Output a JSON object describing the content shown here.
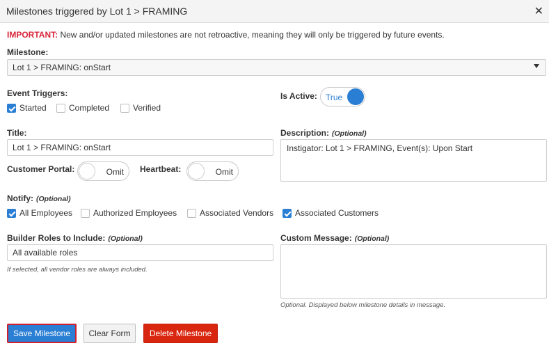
{
  "dialog": {
    "title": "Milestones triggered by Lot 1 > FRAMING",
    "close_glyph": "✕"
  },
  "notice": {
    "label": "IMPORTANT:",
    "text": " New and/or updated milestones are not retroactive, meaning they will only be triggered by future events."
  },
  "milestone": {
    "label": "Milestone:",
    "selected": "Lot 1 > FRAMING: onStart"
  },
  "event_triggers": {
    "label": "Event Triggers:",
    "options": [
      {
        "label": "Started",
        "checked": true
      },
      {
        "label": "Completed",
        "checked": false
      },
      {
        "label": "Verified",
        "checked": false
      }
    ]
  },
  "is_active": {
    "label": "Is Active:",
    "value": "True",
    "on": true
  },
  "title_field": {
    "label": "Title:",
    "value": "Lot 1 > FRAMING: onStart"
  },
  "description": {
    "label": "Description:",
    "optional": "(Optional)",
    "value": "Instigator: Lot 1 > FRAMING, Event(s): Upon Start"
  },
  "customer_portal": {
    "label": "Customer Portal:",
    "value": "Omit",
    "on": false
  },
  "heartbeat": {
    "label": "Heartbeat:",
    "value": "Omit",
    "on": false
  },
  "notify": {
    "label": "Notify:",
    "optional": "(Optional)",
    "options": [
      {
        "label": "All Employees",
        "checked": true
      },
      {
        "label": "Authorized Employees",
        "checked": false
      },
      {
        "label": "Associated Vendors",
        "checked": false
      },
      {
        "label": "Associated Customers",
        "checked": true
      }
    ]
  },
  "builder_roles": {
    "label": "Builder Roles to Include:",
    "optional": "(Optional)",
    "value": "All available roles",
    "help": "If selected, all vendor roles are always included."
  },
  "custom_message": {
    "label": "Custom Message:",
    "optional": "(Optional)",
    "value": "",
    "help": "Optional. Displayed below milestone details in message."
  },
  "buttons": {
    "save": "Save Milestone",
    "clear": "Clear Form",
    "delete": "Delete Milestone"
  },
  "colors": {
    "primary": "#2a7fd4",
    "danger": "#d9260f",
    "important": "#d9263b"
  }
}
